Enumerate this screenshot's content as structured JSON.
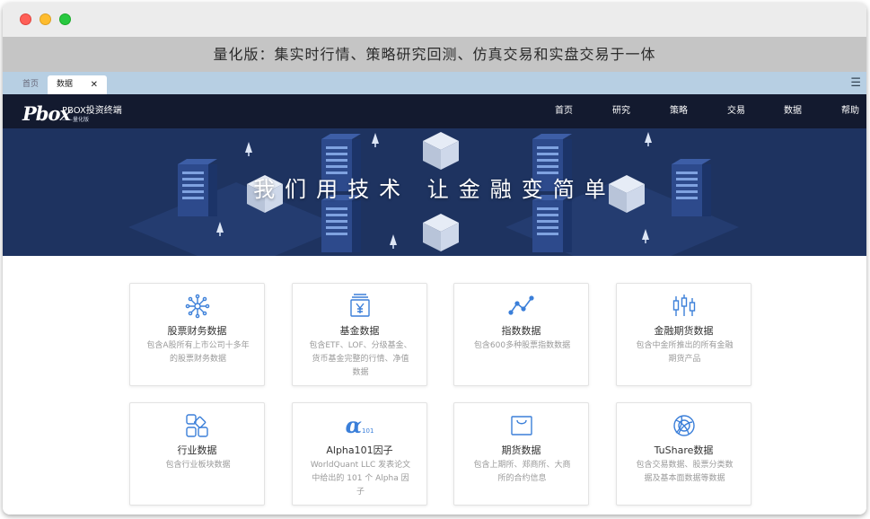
{
  "window": {
    "caption": "量化版：集实时行情、策略研究回测、仿真交易和实盘交易于一体"
  },
  "tabs": [
    {
      "label": "首页",
      "active": false
    },
    {
      "label": "数据",
      "active": true,
      "close": "✕"
    }
  ],
  "menu_icon": "☰",
  "brand": {
    "mark": "Pbox",
    "name": "PBOX投资终端",
    "edition": "——量化版"
  },
  "nav": [
    "首页",
    "研究",
    "策略",
    "交易",
    "数据",
    "帮助"
  ],
  "hero": {
    "slogan": "我们用技术 让金融变简单"
  },
  "cards": [
    {
      "title": "股票财务数据",
      "desc": "包含A股所有上市公司十多年的股票财务数据",
      "icon": "network-icon"
    },
    {
      "title": "基金数据",
      "desc": "包含ETF、LOF、分级基金、货币基金完整的行情、净值数据",
      "icon": "fund-yen-icon"
    },
    {
      "title": "指数数据",
      "desc": "包含600多种股票指数数据",
      "icon": "line-chart-icon"
    },
    {
      "title": "金融期货数据",
      "desc": "包含中金所推出的所有金融期货产品",
      "icon": "candlestick-icon"
    },
    {
      "title": "行业数据",
      "desc": "包含行业板块数据",
      "icon": "blocks-icon"
    },
    {
      "title": "Alpha101因子",
      "desc": "WorldQuant LLC 发表论文中给出的 101 个 Alpha 因子",
      "icon": "alpha-icon",
      "icon_text": "α",
      "icon_sub": "101"
    },
    {
      "title": "期货数据",
      "desc": "包含上期所、郑商所、大商所的合约信息",
      "icon": "basket-icon"
    },
    {
      "title": "TuShare数据",
      "desc": "包含交易数据、股票分类数据及基本面数据等数据",
      "icon": "globe-icon"
    }
  ],
  "colors": {
    "accent": "#3b7fd9",
    "navbar": "#131a2f",
    "hero": "#1e3360",
    "tabbar": "#b7cfe3"
  }
}
